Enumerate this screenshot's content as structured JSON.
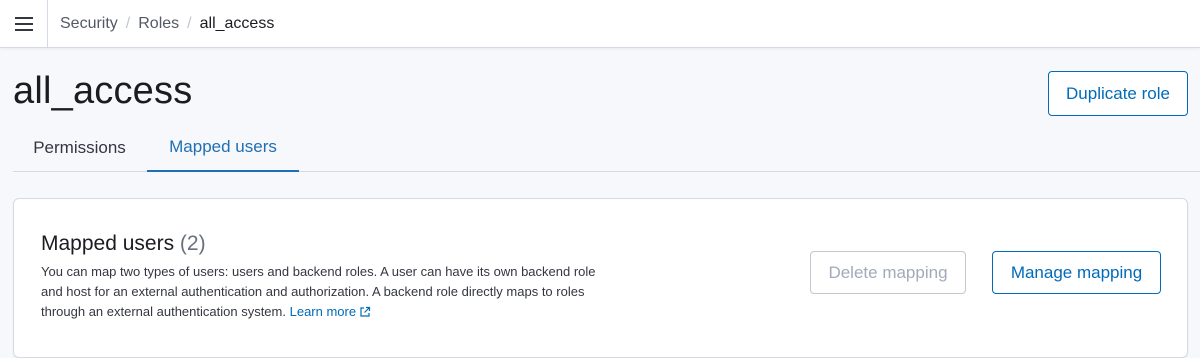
{
  "header": {
    "menu_icon": "hamburger-menu-icon",
    "breadcrumbs": [
      "Security",
      "Roles",
      "all_access"
    ],
    "separator": "/"
  },
  "page": {
    "title": "all_access",
    "duplicate_button": "Duplicate role"
  },
  "tabs": [
    {
      "label": "Permissions",
      "active": false
    },
    {
      "label": "Mapped users",
      "active": true
    }
  ],
  "panel": {
    "title": "Mapped users",
    "count": "(2)",
    "description": "You can map two types of users: users and backend roles. A user can have its own backend role and host for an external authentication and authorization. A backend role directly maps to roles through an external authentication system.",
    "learn_more": "Learn more",
    "learn_more_icon": "external-link-icon",
    "delete_button": "Delete mapping",
    "manage_button": "Manage mapping"
  },
  "colors": {
    "accent": "#006bb8",
    "background": "#f7f8fc",
    "border": "#d3dae6",
    "disabled_text": "#a2abba"
  }
}
